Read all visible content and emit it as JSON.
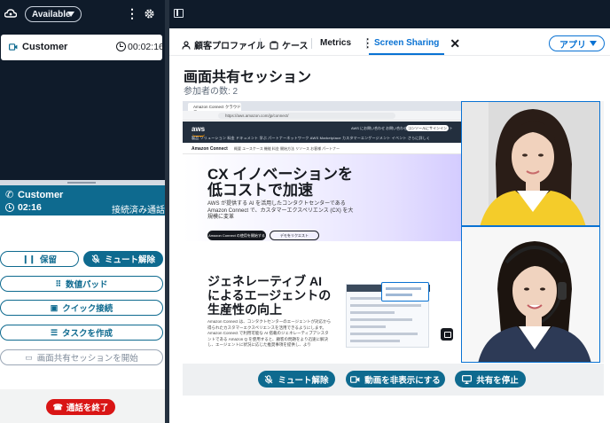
{
  "ccp": {
    "status": "Available",
    "contact_card": {
      "name": "Customer",
      "timer": "00:02:16"
    },
    "active_contact": {
      "name": "Customer",
      "duration": "02:16",
      "state": "接続済み通話"
    },
    "buttons": {
      "hold": "保留",
      "unmute": "ミュート解除",
      "keypad": "数値パッド",
      "quick_connect": "クイック接続",
      "create_task": "タスクを作成",
      "start_screen_share": "画面共有セッションを開始"
    },
    "end_call": "通話を終了"
  },
  "workspace": {
    "tabs": [
      {
        "label": "顧客プロファイル",
        "icon": "person-icon"
      },
      {
        "label": "ケース",
        "icon": "case-icon"
      },
      {
        "label": "Metrics",
        "icon": ""
      },
      {
        "label": "Screen Sharing",
        "icon": ""
      }
    ],
    "active_tab": "Screen Sharing",
    "apps_button": "アプリ",
    "session_title": "画面共有セッション",
    "participants": "参加者の数: 2",
    "shared_screen": {
      "browser_tab": "Amazon Connect クラウドコ...",
      "url": "https://aws.amazon.com/jp/connect/",
      "nav_items": "製品  ソリューション  料金  ドキュメント  学ぶ  パートナーネットワーク  AWS Marketplace  カスタマーエンゲージメント  イベント  さらに詳しく",
      "nav_right": "AWS にお問い合わせ  お問い合わせ  サポート  日本語  アカウント",
      "nav_cta": "コンソールにサインイン",
      "subnav_title": "Amazon Connect",
      "subnav_items": "概要   ユースケース   機能   料金   開始方法   リソース   お客様   パートナー",
      "hero_title": "CX イノベーションを低コストで加速",
      "hero_text": "AWS が提供する AI を活用したコンタクトセンターである Amazon Connect で、カスタマーエクスペリエンス (CX) を大規模に変革",
      "hero_btn_primary": "Amazon Connect の使用を開始する",
      "hero_btn_secondary": "デモをリクエスト",
      "section_title": "ジェネレーティブ AI によるエージェントの生産性の向上",
      "section_text": "Amazon Connect は、コンタクトセンターのエージェントが対応から得られたカスタマーエクスペリエンスを活用できるようにします。Amazon Connect で利用可能な AI 搭載のジェネレーティブアシスタントである Amazon Q を使用すると、顧客の問題をより迅速に解決し、エージェントに状況に応じた推奨事項を提供し、より"
    },
    "controls": {
      "unmute": "ミュート解除",
      "hide_video": "動画を非表示にする",
      "stop_sharing": "共有を停止"
    }
  },
  "colors": {
    "ccp_dark": "#0f1b2a",
    "ccp_teal": "#0e6a8f",
    "accent_blue": "#0972d3",
    "end_red": "#d91515"
  }
}
